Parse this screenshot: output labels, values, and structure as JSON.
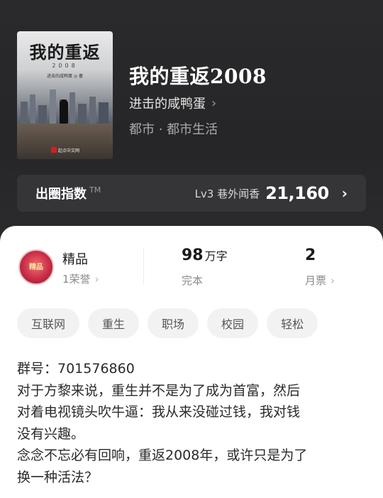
{
  "book": {
    "cover": {
      "title": "我的重返",
      "year": "2008",
      "author": "进击的咸鸭蛋 ◎ 著",
      "publisher": "起点中文网"
    },
    "title": "我的重返2008",
    "author": "进击的咸鸭蛋",
    "genre": "都市 · 都市生活"
  },
  "index_bar": {
    "title": "出圈指数",
    "tm": "TM",
    "level": "Lv3 巷外闻香",
    "value": "21,160"
  },
  "stats": {
    "badge_text": "精品",
    "quality_label": "精品",
    "honor": "1荣誉",
    "word_count": "98",
    "word_unit": "万字",
    "status": "完本",
    "monthly_tickets": "2",
    "monthly_label": "月票"
  },
  "tags": [
    "互联网",
    "重生",
    "职场",
    "校园",
    "轻松"
  ],
  "description": [
    "群号：701576860",
    "对于方黎来说，重生并不是为了成为首富，然后",
    "对着电视镜头吹牛逼：我从来没碰过钱，我对钱",
    "没有兴趣。",
    "念念不忘必有回响，重返2008年，或许只是为了",
    "换一种活法？"
  ],
  "colors": {
    "background": "#262628",
    "sheet": "#ffffff",
    "tag_bg": "#f2f2f3"
  }
}
